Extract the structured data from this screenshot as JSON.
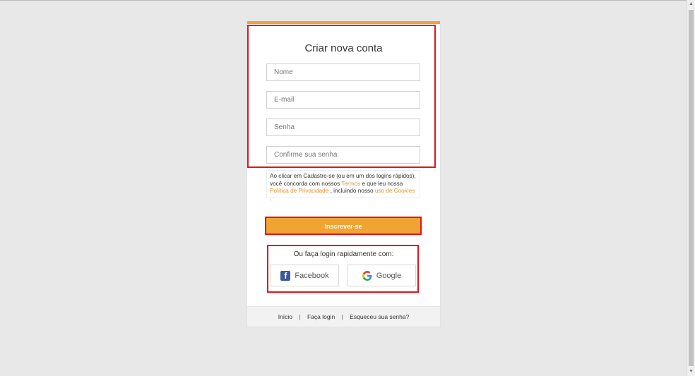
{
  "signup": {
    "title": "Criar nova conta",
    "fields": {
      "name_placeholder": "Nome",
      "email_placeholder": "E-mail",
      "password_placeholder": "Senha",
      "confirm_placeholder": "Confirme sua senha"
    },
    "terms": {
      "text1": "Ao clicar em Cadastre-se (ou em um dos logins rápidos), você concorda com nossos",
      "link_terms": "Termos",
      "text2": "e que leu nossa",
      "link_privacy": "Política de Privacidade",
      "text3": ", incluindo nosso",
      "link_cookies": "uso de Cookies",
      "text4": "."
    },
    "submit_label": "Inscrever-se",
    "quick_login_title": "Ou faça login rapidamente com:",
    "facebook_label": "Facebook",
    "google_label": "Google"
  },
  "footer": {
    "home": "Início",
    "sep1": "|",
    "login": "Faça login",
    "sep2": "|",
    "forgot": "Esqueceu sua senha?"
  },
  "colors": {
    "accent": "#f0a433",
    "link": "#e8902a",
    "highlight": "#e3131e",
    "facebook": "#3b5998"
  },
  "icons": [
    "facebook-icon",
    "google-icon"
  ]
}
